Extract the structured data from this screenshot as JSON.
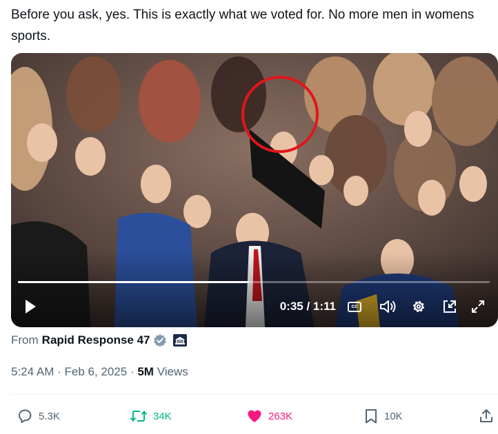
{
  "tweet": {
    "text": "Before you ask, yes. This is exactly what we voted for. No more men in womens sports."
  },
  "video": {
    "elapsed_fraction": 0.49,
    "time_display": "0:35 / 1:11",
    "cc_label": "cc",
    "highlight_color": "#e0161b",
    "icons": [
      "play-icon",
      "captions-icon",
      "volume-icon",
      "settings-icon",
      "pip-icon",
      "fullscreen-icon"
    ]
  },
  "source": {
    "prefix": "From",
    "name": "Rapid Response 47",
    "verified_color": "#829aab"
  },
  "meta": {
    "time": "5:24 AM",
    "sep1": " · ",
    "date": "Feb 6, 2025",
    "sep2": " · ",
    "views_count": "5M",
    "views_label": " Views"
  },
  "actions": {
    "replies": "5.3K",
    "reposts": "34K",
    "likes": "263K",
    "bookmarks": "10K"
  },
  "colors": {
    "text": "#0f1419",
    "secondary": "#536471",
    "repost": "#00ba7c",
    "like": "#f91880"
  }
}
